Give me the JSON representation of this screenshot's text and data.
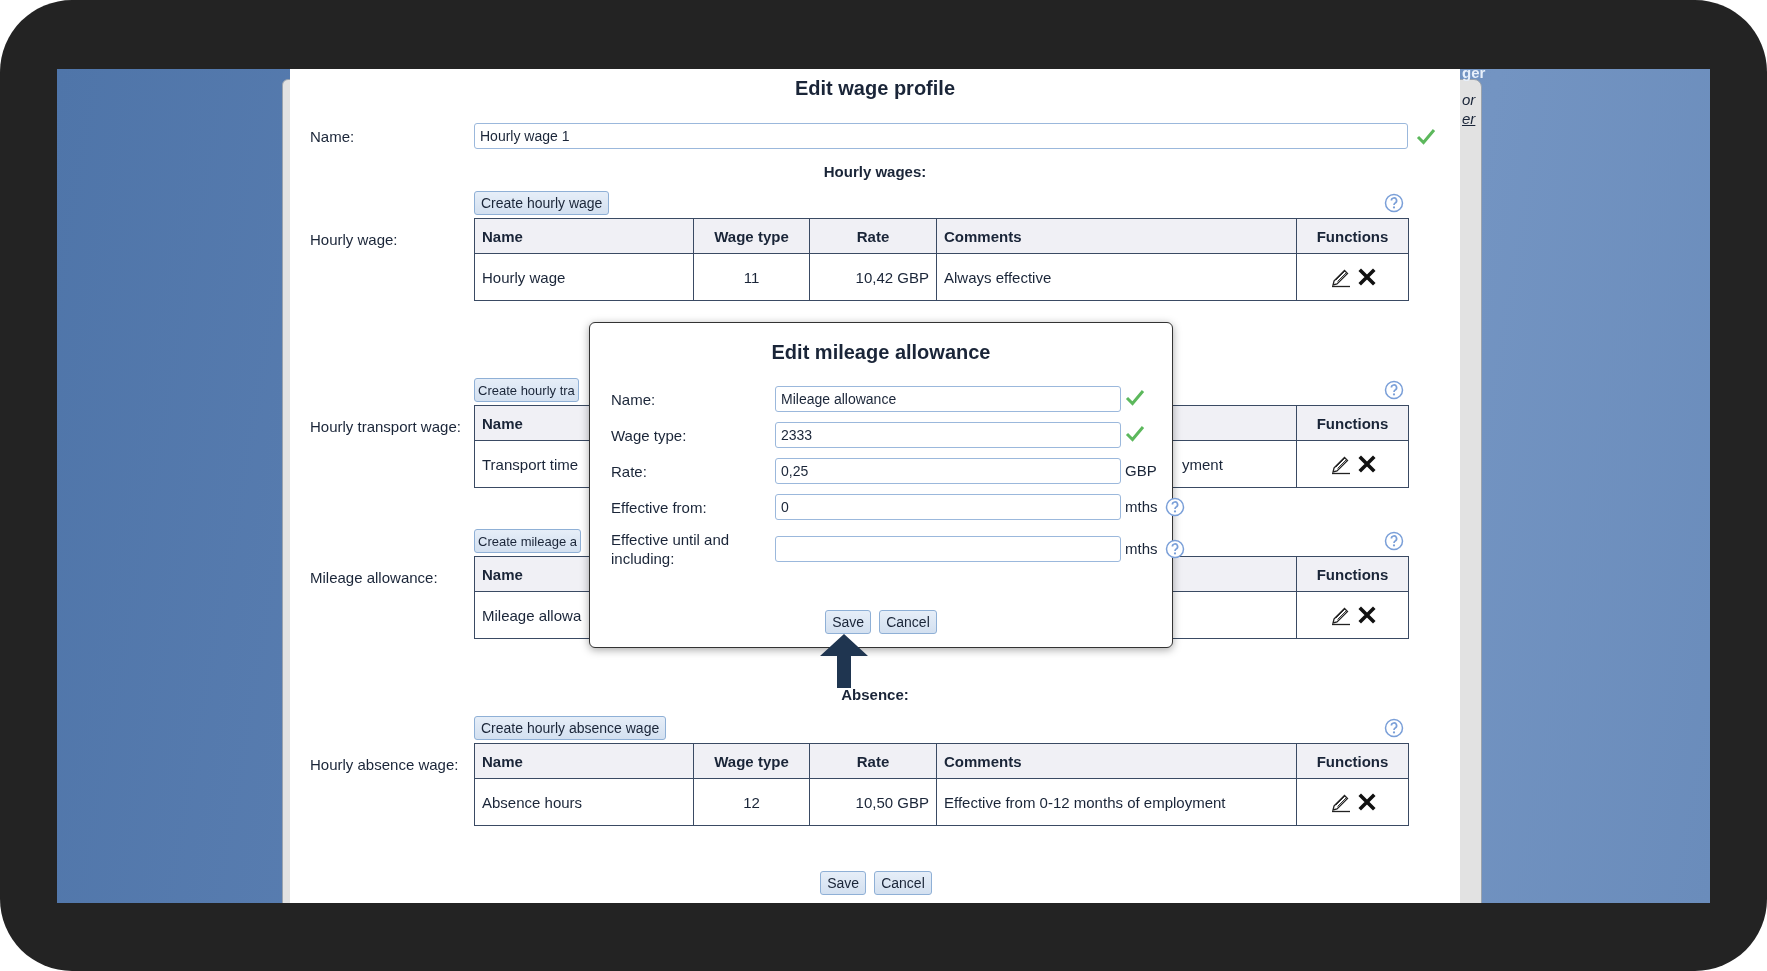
{
  "background_window": {
    "texts": [
      {
        "text": "ger",
        "kind": "heading"
      },
      {
        "text": "or",
        "kind": "italic"
      },
      {
        "text": "er",
        "kind": "link"
      }
    ]
  },
  "dialog": {
    "title": "Edit wage profile",
    "name_field": {
      "label": "Name:",
      "value": "Hourly wage 1",
      "valid": true
    },
    "sections": [
      {
        "heading": "Hourly wages:",
        "groups": [
          {
            "label": "Hourly wage:",
            "create_button": "Create hourly wage",
            "covered": false,
            "columns": [
              "Name",
              "Wage type",
              "Rate",
              "Comments",
              "Functions"
            ],
            "rows": [
              {
                "cells": [
                  "Hourly wage",
                  "11",
                  "10,42 GBP",
                  "Always effective"
                ]
              }
            ]
          },
          {
            "label": "Hourly transport wage:",
            "create_button": "Create hourly tra",
            "covered": true,
            "columns": [
              "Name",
              null,
              null,
              null,
              "Functions"
            ],
            "rows": [
              {
                "cells": [
                  "Transport time",
                  null,
                  null,
                  "yment"
                ]
              }
            ]
          },
          {
            "label": "Mileage allowance:",
            "create_button": "Create mileage a",
            "covered": true,
            "columns": [
              "Name",
              null,
              null,
              null,
              "Functions"
            ],
            "rows": [
              {
                "cells": [
                  "Mileage allowa",
                  null,
                  null,
                  null
                ]
              }
            ]
          }
        ]
      },
      {
        "heading": "Absence:",
        "groups": [
          {
            "label": "Hourly absence wage:",
            "create_button": "Create hourly absence wage",
            "covered": false,
            "columns": [
              "Name",
              "Wage type",
              "Rate",
              "Comments",
              "Functions"
            ],
            "rows": [
              {
                "cells": [
                  "Absence hours",
                  "12",
                  "10,50 GBP",
                  "Effective from 0-12 months of employment"
                ]
              }
            ]
          }
        ]
      }
    ],
    "buttons": [
      "Save",
      "Cancel"
    ]
  },
  "modal": {
    "title": "Edit mileage allowance",
    "fields": [
      {
        "label": "Name:",
        "value": "Mileage allowance",
        "valid": true,
        "help": false
      },
      {
        "label": "Wage type:",
        "value": "2333",
        "valid": true,
        "help": false
      },
      {
        "label": "Rate:",
        "value": "0,25",
        "unit": "GBP",
        "valid": false,
        "help": false
      },
      {
        "label": "Effective from:",
        "value": "0",
        "unit": "mths",
        "valid": false,
        "help": true
      },
      {
        "label": "Effective until and including:",
        "unit": "mths",
        "valid": false,
        "help": true
      }
    ],
    "buttons": [
      "Save",
      "Cancel"
    ]
  }
}
